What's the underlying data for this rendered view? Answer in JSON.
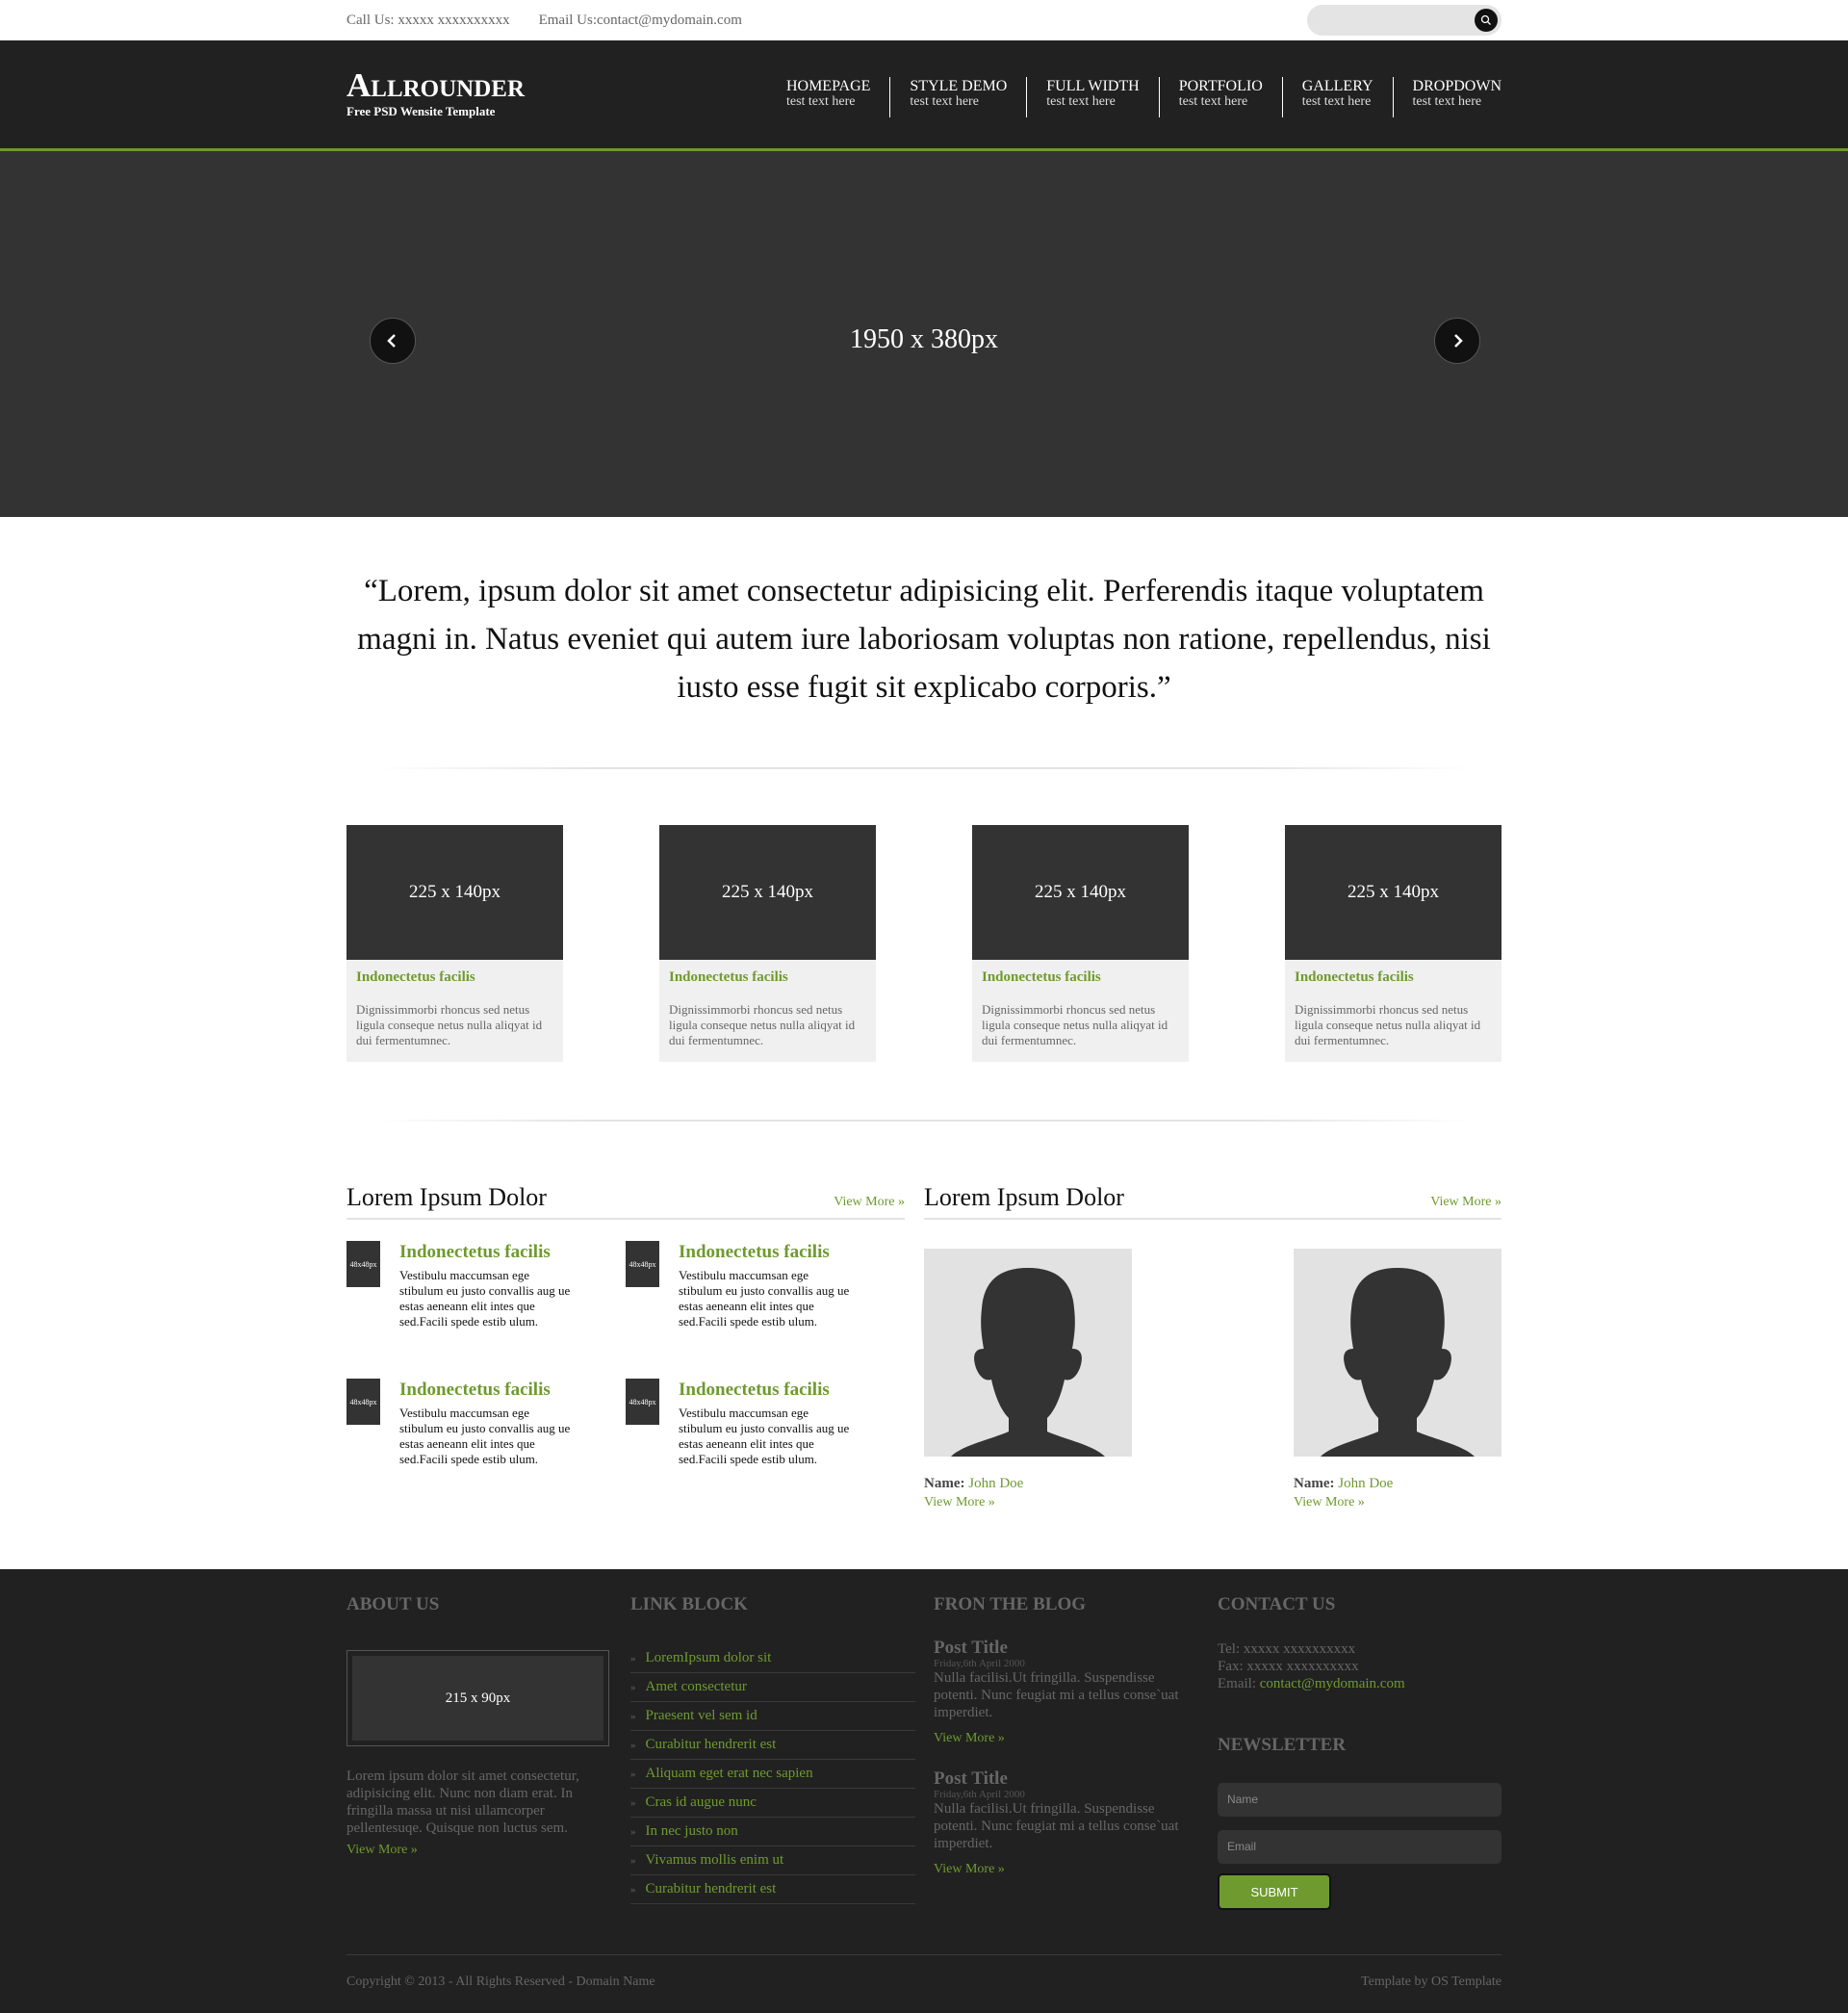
{
  "topbar": {
    "call": "Call Us: xxxxx xxxxxxxxxx",
    "email": "Email Us:contact@mydomain.com"
  },
  "logo": {
    "name": "Allrounder",
    "tagline": "Free PSD Wensite Template"
  },
  "nav": [
    {
      "title": "HOMEPAGE",
      "sub": "test text here"
    },
    {
      "title": "STYLE DEMO",
      "sub": "test text here"
    },
    {
      "title": "FULL WIDTH",
      "sub": "test text here"
    },
    {
      "title": "PORTFOLIO",
      "sub": "test text here"
    },
    {
      "title": "GALLERY",
      "sub": "test text here"
    },
    {
      "title": "DROPDOWN",
      "sub": "test text here"
    }
  ],
  "slider": {
    "label": "1950 x 380px"
  },
  "quote": "“Lorem, ipsum dolor sit amet consectetur adipisicing elit. Perferendis itaque voluptatem magni in. Natus eveniet qui autem iure laboriosam voluptas non ratione, repellendus, nisi iusto esse fugit sit explicabo corporis.”",
  "features": [
    {
      "img": "225 x 140px",
      "title": "Indonectetus facilis",
      "text": "Dignissimmorbi rhoncus sed netus ligula conseque netus nulla aliqyat id dui fermentumnec."
    },
    {
      "img": "225 x 140px",
      "title": "Indonectetus facilis",
      "text": "Dignissimmorbi rhoncus sed netus ligula conseque netus nulla aliqyat id dui fermentumnec."
    },
    {
      "img": "225 x 140px",
      "title": "Indonectetus facilis",
      "text": "Dignissimmorbi rhoncus sed netus ligula conseque netus nulla aliqyat id dui fermentumnec."
    },
    {
      "img": "225 x 140px",
      "title": "Indonectetus facilis",
      "text": "Dignissimmorbi rhoncus sed netus ligula conseque netus nulla aliqyat id dui fermentumnec."
    }
  ],
  "left_section": {
    "title": "Lorem Ipsum Dolor",
    "view_more": "View More »",
    "posts": [
      {
        "thumb": "48x48px",
        "title": "Indonectetus facilis",
        "text": "Vestibulu maccumsan ege stibulum eu justo convallis aug ue estas aeneann elit intes que sed.Facili spede estib ulum."
      },
      {
        "thumb": "48x48px",
        "title": "Indonectetus facilis",
        "text": "Vestibulu maccumsan ege stibulum eu justo convallis aug ue estas aeneann elit intes que sed.Facili spede estib ulum."
      },
      {
        "thumb": "48x48px",
        "title": "Indonectetus facilis",
        "text": "Vestibulu maccumsan ege stibulum eu justo convallis aug ue estas aeneann elit intes que sed.Facili spede estib ulum."
      },
      {
        "thumb": "48x48px",
        "title": "Indonectetus facilis",
        "text": "Vestibulu maccumsan ege stibulum eu justo convallis aug ue estas aeneann elit intes que sed.Facili spede estib ulum."
      }
    ]
  },
  "right_section": {
    "title": "Lorem Ipsum Dolor",
    "view_more": "View More »",
    "members": [
      {
        "label": "Name:",
        "name": "John Doe",
        "view_more": "View More »"
      },
      {
        "label": "Name:",
        "name": "John Doe",
        "view_more": "View More »"
      }
    ]
  },
  "footer": {
    "about": {
      "title": "ABOUT US",
      "img": "215 x 90px",
      "text": "Lorem ipsum dolor sit amet consectetur, adipisicing elit. Nunc non diam erat. In fringilla massa ut nisi ullamcorper pellentesuqe. Quisque non luctus sem.",
      "view_more": "View More »"
    },
    "links": {
      "title": "LINK BLOCK",
      "items": [
        "LoremIpsum dolor sit",
        "Amet consectetur",
        "Praesent vel sem id",
        "Curabitur hendrerit est",
        "Aliquam eget erat nec sapien",
        "Cras id augue nunc",
        "In nec justo non",
        "Vivamus mollis enim ut",
        "Curabitur hendrerit est"
      ]
    },
    "blog": {
      "title": "FRON THE BLOG",
      "posts": [
        {
          "title": "Post Title",
          "date": "Friday,6th April 2000",
          "text": "Nulla facilisi.Ut fringilla. Suspendisse potenti. Nunc feugiat mi a tellus conse`uat imperdiet.",
          "view_more": "View More »"
        },
        {
          "title": "Post Title",
          "date": "Friday,6th April 2000",
          "text": "Nulla facilisi.Ut fringilla. Suspendisse potenti. Nunc feugiat mi a tellus conse`uat imperdiet.",
          "view_more": "View More »"
        }
      ]
    },
    "contact": {
      "title": "CONTACT US",
      "tel": "Tel: xxxxx xxxxxxxxxx",
      "fax": "Fax: xxxxx xxxxxxxxxx",
      "email_label": "Email: ",
      "email": "contact@mydomain.com",
      "newsletter_title": "NEWSLETTER",
      "name_placeholder": "Name",
      "email_placeholder": "Email",
      "submit": "SUBMIT"
    },
    "copyright": "Copyright © 2013 - All Rights Reserved - Domain Name",
    "credit": "Template by OS Template"
  },
  "colors": {
    "accent": "#6f9a2f",
    "dark": "#212121",
    "slider": "#333333"
  }
}
